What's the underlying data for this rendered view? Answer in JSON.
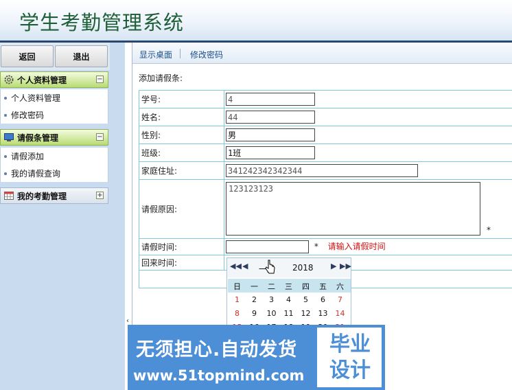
{
  "header": {
    "title": "学生考勤管理系统"
  },
  "sidebar": {
    "back_label": "返回",
    "exit_label": "退出",
    "sections": [
      {
        "label": "个人资料管理",
        "toggle": "−",
        "items": [
          "个人资料管理",
          "修改密码"
        ]
      },
      {
        "label": "请假条管理",
        "toggle": "−",
        "items": [
          "请假添加",
          "我的请假查询"
        ]
      },
      {
        "label": "我的考勤管理",
        "toggle": "+"
      }
    ]
  },
  "tabs": [
    "显示桌面",
    "修改密码"
  ],
  "form": {
    "caption": "添加请假条:",
    "fields": {
      "student_id": {
        "label": "学号:",
        "value": "4"
      },
      "name": {
        "label": "姓名:",
        "value": "44"
      },
      "gender": {
        "label": "性别:",
        "value": "男"
      },
      "class": {
        "label": "班级:",
        "value": "1班"
      },
      "address": {
        "label": "家庭住址:",
        "value": "341242342342344"
      },
      "reason": {
        "label": "请假原因:",
        "value": "123123123"
      },
      "leave_time": {
        "label": "请假时间:",
        "value": "",
        "error": "请输入请假时间"
      },
      "return_time": {
        "label": "回来时间:"
      }
    },
    "required_mark": "*"
  },
  "calendar": {
    "month": "一月",
    "year": "2018",
    "weekdays": [
      "日",
      "一",
      "二",
      "三",
      "四",
      "五",
      "六"
    ],
    "rows": [
      [
        "1",
        "2",
        "3",
        "4",
        "5",
        "6",
        "7"
      ],
      [
        "8",
        "9",
        "10",
        "11",
        "12",
        "13",
        "14"
      ],
      [
        "15",
        "16",
        "17",
        "18",
        "19",
        "20",
        "21"
      ]
    ]
  },
  "watermark": {
    "line1": "无须担心.自动发货",
    "line2": "www.51topmind.com",
    "badge": "毕业设计"
  }
}
